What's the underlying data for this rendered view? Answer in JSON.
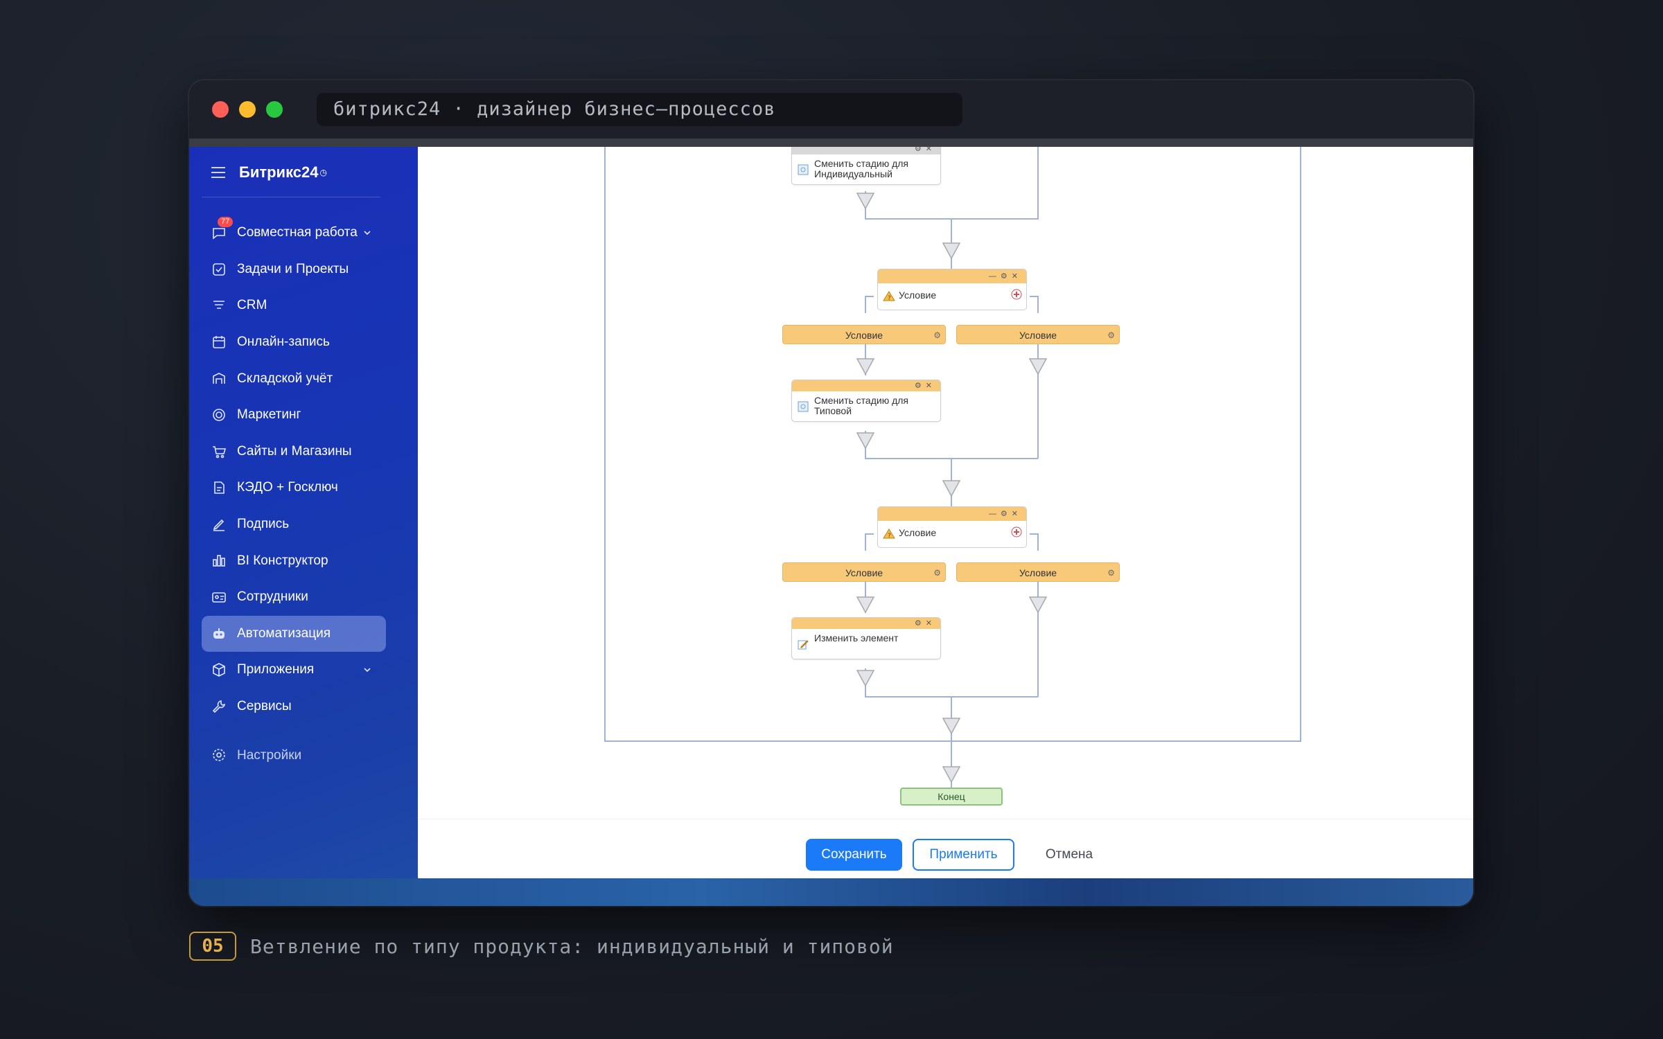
{
  "window": {
    "title": "битрикс24 · дизайнер бизнес–процессов"
  },
  "sidebar": {
    "logo": "Битрикс24",
    "logo_mark": "◷",
    "items": [
      {
        "label": "Совместная работа",
        "icon": "chat-icon",
        "badge": "77",
        "expandable": true
      },
      {
        "label": "Задачи и Проекты",
        "icon": "checkbox-icon"
      },
      {
        "label": "CRM",
        "icon": "filter-icon"
      },
      {
        "label": "Онлайн-запись",
        "icon": "calendar-icon"
      },
      {
        "label": "Складской учёт",
        "icon": "warehouse-icon"
      },
      {
        "label": "Маркетинг",
        "icon": "target-icon"
      },
      {
        "label": "Сайты и Магазины",
        "icon": "cart-icon"
      },
      {
        "label": "КЭДО + Госключ",
        "icon": "document-icon"
      },
      {
        "label": "Подпись",
        "icon": "pen-icon"
      },
      {
        "label": "BI Конструктор",
        "icon": "bar-chart-icon"
      },
      {
        "label": "Сотрудники",
        "icon": "id-card-icon"
      },
      {
        "label": "Автоматизация",
        "icon": "robot-icon",
        "active": true
      },
      {
        "label": "Приложения",
        "icon": "cube-icon",
        "expandable": true
      },
      {
        "label": "Сервисы",
        "icon": "wrench-icon"
      }
    ],
    "settings_label": "Настройки"
  },
  "workflow": {
    "top_action": "Сменить стадию для\nИндивидуальный",
    "condition1": {
      "label": "Условие",
      "branch_left": "Условие",
      "branch_right": "Условие",
      "action": "Сменить стадию для\nТиповой"
    },
    "condition2": {
      "label": "Условие",
      "branch_left": "Условие",
      "branch_right": "Условие",
      "action": "Изменить элемент"
    },
    "end_label": "Конец"
  },
  "footer": {
    "save_label": "Сохранить",
    "apply_label": "Применить",
    "cancel_label": "Отмена"
  },
  "caption": {
    "number": "05",
    "text": "Ветвление по типу продукта: индивидуальный и типовой"
  },
  "colors": {
    "accent": "#1a7af8",
    "block_header": "#f9c97a",
    "end_block": "#d7f0c8",
    "sidebar": "#1a2fb8"
  }
}
